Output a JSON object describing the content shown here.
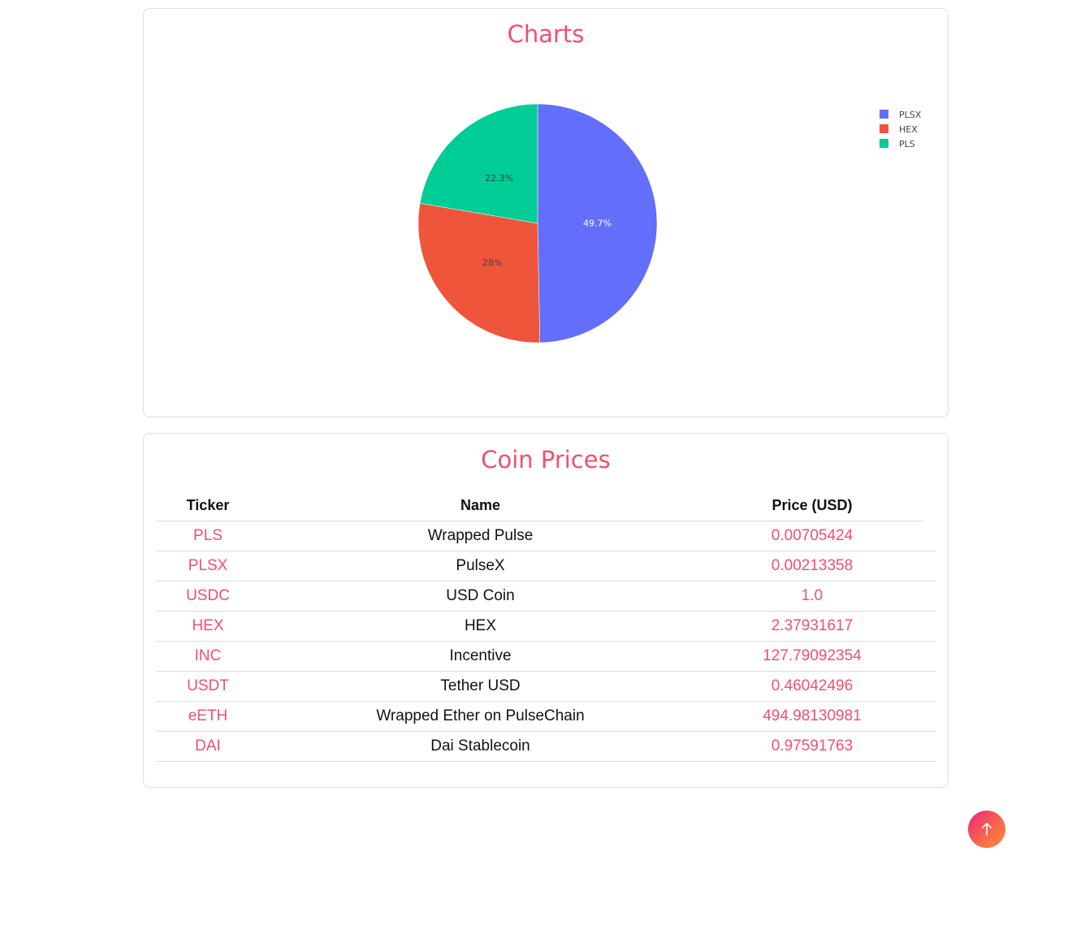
{
  "charts_section": {
    "title": "Charts"
  },
  "chart_data": {
    "type": "pie",
    "slices": [
      {
        "label": "PLSX",
        "value": 49.7,
        "text": "49.7%",
        "color": "#636efa",
        "text_color": "#ffffff"
      },
      {
        "label": "HEX",
        "value": 28.0,
        "text": "28%",
        "color": "#ef553b",
        "text_color": "#444444"
      },
      {
        "label": "PLS",
        "value": 22.3,
        "text": "22.3%",
        "color": "#00cc96",
        "text_color": "#444444"
      }
    ],
    "legend": [
      "PLSX",
      "HEX",
      "PLS"
    ],
    "legend_placement": "top-right",
    "direction": "clockwise",
    "start_angle_deg": 0
  },
  "prices_section": {
    "title": "Coin Prices",
    "columns": [
      "Ticker",
      "Name",
      "Price (USD)"
    ],
    "rows": [
      [
        "PLS",
        "Wrapped Pulse",
        "0.00705424"
      ],
      [
        "PLSX",
        "PulseX",
        "0.00213358"
      ],
      [
        "USDC",
        "USD Coin",
        "1.0"
      ],
      [
        "HEX",
        "HEX",
        "2.37931617"
      ],
      [
        "INC",
        "Incentive",
        "127.79092354"
      ],
      [
        "USDT",
        "Tether USD",
        "0.46042496"
      ],
      [
        "eETH",
        "Wrapped Ether on PulseChain",
        "494.98130981"
      ],
      [
        "DAI",
        "Dai Stablecoin",
        "0.97591763"
      ]
    ]
  },
  "scroll_top": {
    "icon": "arrow-up-icon",
    "gradient": [
      "#f0237c",
      "#fb8a3c"
    ]
  }
}
